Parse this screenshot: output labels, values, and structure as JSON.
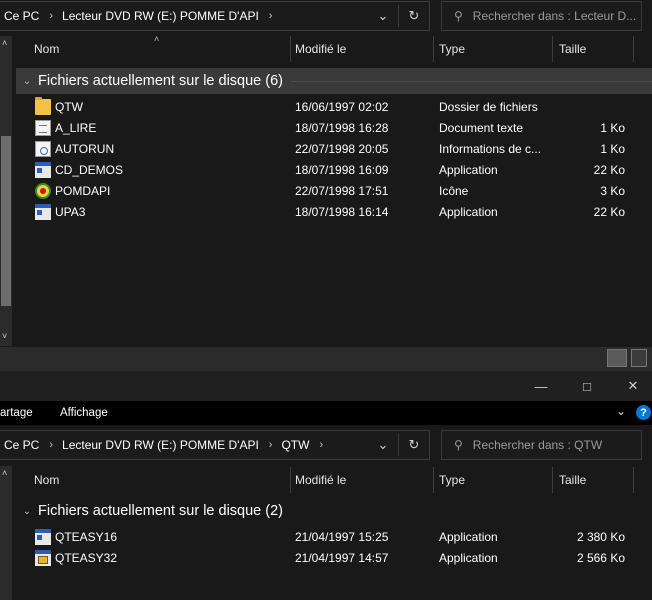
{
  "top_window": {
    "breadcrumb": [
      "Ce PC",
      "Lecteur DVD RW (E:) POMME D'API"
    ],
    "search_placeholder": "Rechercher dans : Lecteur D...",
    "columns": {
      "name": "Nom",
      "modified": "Modifié le",
      "type": "Type",
      "size": "Taille"
    },
    "group_title": "Fichiers actuellement sur le disque (6)",
    "files": [
      {
        "name": "QTW",
        "modified": "16/06/1997 02:02",
        "type": "Dossier de fichiers",
        "size": "",
        "icon": "folder-icon"
      },
      {
        "name": "A_LIRE",
        "modified": "18/07/1998 16:28",
        "type": "Document texte",
        "size": "1 Ko",
        "icon": "text-document-icon"
      },
      {
        "name": "AUTORUN",
        "modified": "22/07/1998 20:05",
        "type": "Informations de c...",
        "size": "1 Ko",
        "icon": "setup-information-icon"
      },
      {
        "name": "CD_DEMOS",
        "modified": "18/07/1998 16:09",
        "type": "Application",
        "size": "22 Ko",
        "icon": "application-icon"
      },
      {
        "name": "POMDAPI",
        "modified": "22/07/1998 17:51",
        "type": "Icône",
        "size": "3 Ko",
        "icon": "pomme-icon"
      },
      {
        "name": "UPA3",
        "modified": "18/07/1998 16:14",
        "type": "Application",
        "size": "22 Ko",
        "icon": "application-icon"
      }
    ]
  },
  "bottom_window": {
    "ribbon_tabs": [
      "artage",
      "Affichage"
    ],
    "breadcrumb": [
      "Ce PC",
      "Lecteur DVD RW (E:) POMME D'API",
      "QTW"
    ],
    "search_placeholder": "Rechercher dans : QTW",
    "columns": {
      "name": "Nom",
      "modified": "Modifié le",
      "type": "Type",
      "size": "Taille"
    },
    "group_title": "Fichiers actuellement sur le disque (2)",
    "files": [
      {
        "name": "QTEASY16",
        "modified": "21/04/1997 15:25",
        "type": "Application",
        "size": "2 380 Ko",
        "icon": "application-icon"
      },
      {
        "name": "QTEASY32",
        "modified": "21/04/1997 14:57",
        "type": "Application",
        "size": "2 566 Ko",
        "icon": "application-icon"
      }
    ]
  },
  "icons": {
    "search": "search-icon",
    "refresh": "refresh-icon",
    "dropdown": "chevron-down-icon",
    "minimize": "minimize-icon",
    "maximize": "maximize-icon",
    "close": "close-icon",
    "help": "help-icon"
  },
  "colors": {
    "background": "#191919",
    "folder": "#f3c244",
    "help_accent": "#0078d4"
  }
}
